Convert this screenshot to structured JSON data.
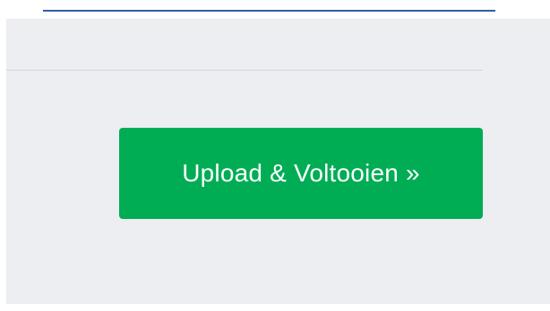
{
  "colors": {
    "accent_line": "#2e5fa8",
    "panel_background": "#eceef1",
    "divider": "#d3d6da",
    "button_background": "#00ad55",
    "button_text": "#ffffff"
  },
  "actions": {
    "upload_complete_label": "Upload & Voltooien »"
  }
}
